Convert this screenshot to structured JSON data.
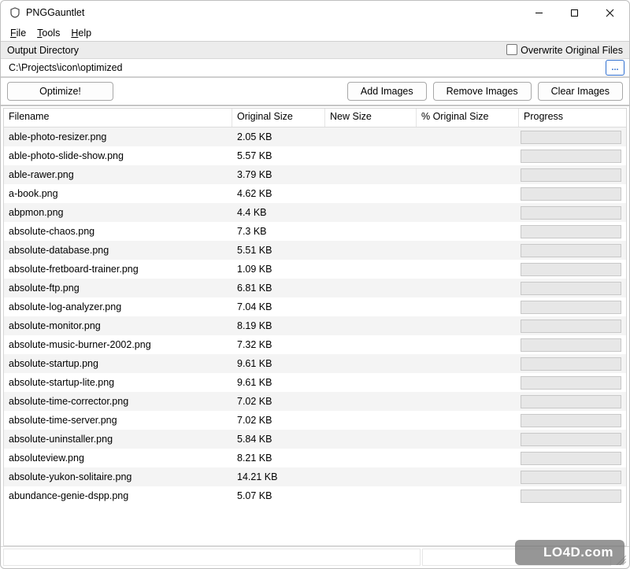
{
  "window": {
    "title": "PNGGauntlet"
  },
  "menu": {
    "file": {
      "text": "File",
      "ukey": "F"
    },
    "tools": {
      "text": "Tools",
      "ukey": "T"
    },
    "help": {
      "text": "Help",
      "ukey": "H"
    }
  },
  "outdir": {
    "label": "Output Directory",
    "overwrite_label": "Overwrite Original Files",
    "path": "C:\\Projects\\icon\\optimized",
    "browse_label": "..."
  },
  "actions": {
    "optimize": "Optimize!",
    "add": "Add Images",
    "remove": "Remove Images",
    "clear": "Clear Images"
  },
  "columns": {
    "filename": "Filename",
    "orig": "Original Size",
    "new": "New Size",
    "pct": "% Original Size",
    "progress": "Progress"
  },
  "rows": [
    {
      "filename": "able-photo-resizer.png",
      "orig": "2.05 KB"
    },
    {
      "filename": "able-photo-slide-show.png",
      "orig": "5.57 KB"
    },
    {
      "filename": "able-rawer.png",
      "orig": "3.79 KB"
    },
    {
      "filename": "a-book.png",
      "orig": "4.62 KB"
    },
    {
      "filename": "abpmon.png",
      "orig": "4.4 KB"
    },
    {
      "filename": "absolute-chaos.png",
      "orig": "7.3 KB"
    },
    {
      "filename": "absolute-database.png",
      "orig": "5.51 KB"
    },
    {
      "filename": "absolute-fretboard-trainer.png",
      "orig": "1.09 KB"
    },
    {
      "filename": "absolute-ftp.png",
      "orig": "6.81 KB"
    },
    {
      "filename": "absolute-log-analyzer.png",
      "orig": "7.04 KB"
    },
    {
      "filename": "absolute-monitor.png",
      "orig": "8.19 KB"
    },
    {
      "filename": "absolute-music-burner-2002.png",
      "orig": "7.32 KB"
    },
    {
      "filename": "absolute-startup.png",
      "orig": "9.61 KB"
    },
    {
      "filename": "absolute-startup-lite.png",
      "orig": "9.61 KB"
    },
    {
      "filename": "absolute-time-corrector.png",
      "orig": "7.02 KB"
    },
    {
      "filename": "absolute-time-server.png",
      "orig": "7.02 KB"
    },
    {
      "filename": "absolute-uninstaller.png",
      "orig": "5.84 KB"
    },
    {
      "filename": "absoluteview.png",
      "orig": "8.21 KB"
    },
    {
      "filename": "absolute-yukon-solitaire.png",
      "orig": "14.21 KB"
    },
    {
      "filename": "abundance-genie-dspp.png",
      "orig": "5.07 KB"
    }
  ],
  "watermark": "LO4D.com"
}
